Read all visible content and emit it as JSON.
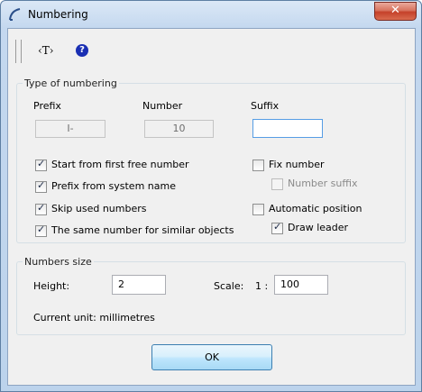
{
  "window": {
    "title": "Numbering",
    "close_symbol": "✕"
  },
  "toolbar": {
    "text_tool_label": "‹T›",
    "help_symbol": "?"
  },
  "type_group": {
    "title": "Type of numbering",
    "prefix": {
      "label": "Prefix",
      "value": "I-"
    },
    "number": {
      "label": "Number",
      "value": "10"
    },
    "suffix": {
      "label": "Suffix",
      "value": ""
    },
    "options": {
      "start_first_free": {
        "label": "Start from first free number",
        "checked": true
      },
      "prefix_system_name": {
        "label": "Prefix from system name",
        "checked": true
      },
      "skip_used": {
        "label": "Skip used numbers",
        "checked": true
      },
      "same_number_similar": {
        "label": "The same number for similar objects",
        "checked": true
      },
      "fix_number": {
        "label": "Fix number",
        "checked": false
      },
      "number_suffix": {
        "label": "Number suffix",
        "checked": false,
        "enabled": false
      },
      "automatic_position": {
        "label": "Automatic position",
        "checked": false
      },
      "draw_leader": {
        "label": "Draw leader",
        "checked": true
      }
    }
  },
  "size_group": {
    "title": "Numbers size",
    "height": {
      "label": "Height:",
      "value": "2"
    },
    "scale": {
      "label": "Scale:",
      "ratio_prefix": "1 :",
      "value": "100"
    },
    "current_unit": "Current unit: millimetres"
  },
  "ok_button": {
    "label": "OK"
  }
}
